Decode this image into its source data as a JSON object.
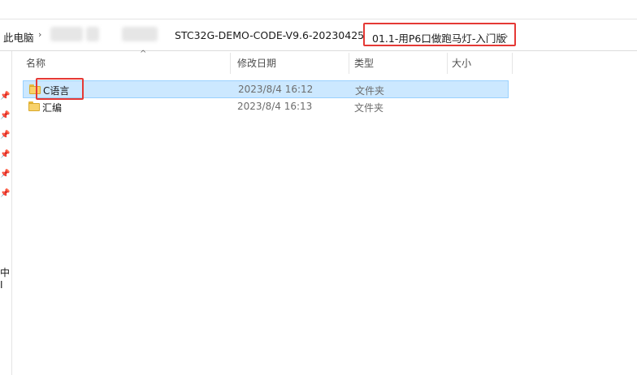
{
  "breadcrumb": {
    "root": "此电脑",
    "folder": "STC32G-DEMO-CODE-V9.6-20230425",
    "current": "01.1-用P6口做跑马灯-入门版"
  },
  "columns": {
    "name": "名称",
    "modified": "修改日期",
    "type": "类型",
    "size": "大小"
  },
  "files": [
    {
      "name": "C语言",
      "modified": "2023/8/4 16:12",
      "type": "文件夹",
      "size": "",
      "selected": true
    },
    {
      "name": "汇编",
      "modified": "2023/8/4 16:13",
      "type": "文件夹",
      "size": "",
      "selected": false
    }
  ],
  "nav": {
    "partial_label": "中I"
  }
}
